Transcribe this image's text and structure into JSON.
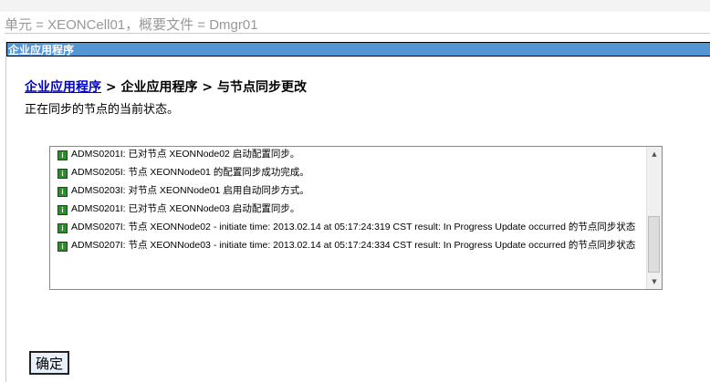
{
  "scope": "单元 = XEONCell01，概要文件 = Dmgr01",
  "panel_title": "企业应用程序",
  "breadcrumb": {
    "link": "企业应用程序",
    "sep1": " > 企业应用程序",
    "sep2": " > 与节点同步更改"
  },
  "description": "正在同步的节点的当前状态。",
  "log": [
    "ADMS0201I: 已对节点 XEONNode02 启动配置同步。",
    "ADMS0205I: 节点 XEONNode01 的配置同步成功完成。",
    "ADMS0203I: 对节点 XEONNode01 启用自动同步方式。",
    "ADMS0201I: 已对节点 XEONNode03 启动配置同步。",
    "ADMS0207I: 节点 XEONNode02 - initiate time: 2013.02.14 at 05:17:24:319 CST result: In Progress Update occurred 的节点同步状态",
    "ADMS0207I: 节点 XEONNode03 - initiate time: 2013.02.14 at 05:17:24:334 CST result: In Progress Update occurred 的节点同步状态"
  ],
  "ok_label": "确定"
}
